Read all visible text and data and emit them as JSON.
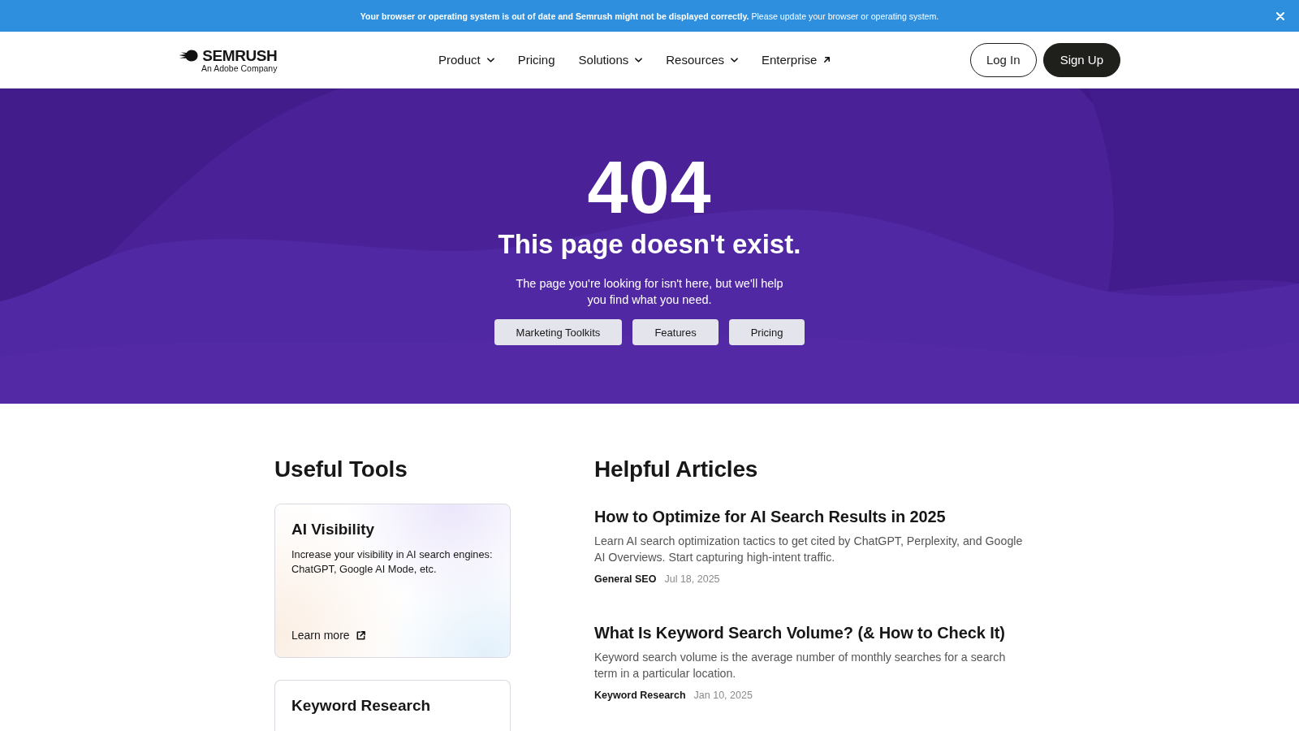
{
  "banner": {
    "message": "**Your browser or operating system is out of date and Semrush might not be displayed correctly.** Please update your browser or operating system."
  },
  "header": {
    "logo": {
      "name": "SEMRUSH",
      "tagline": "An Adobe Company"
    },
    "nav": [
      {
        "label": "Product",
        "kind": "dropdown"
      },
      {
        "label": "Pricing",
        "kind": "link"
      },
      {
        "label": "Solutions",
        "kind": "dropdown"
      },
      {
        "label": "Resources",
        "kind": "dropdown"
      },
      {
        "label": "Enterprise",
        "kind": "external"
      }
    ],
    "buttons": [
      {
        "label": "Log In",
        "kind": "outline"
      },
      {
        "label": "Sign Up",
        "kind": "primary"
      }
    ]
  },
  "hero": {
    "code": "404",
    "title": "This page doesn't exist.",
    "text": "The page you're looking for isn't here, but we'll help you find what you need.",
    "buttons": [
      "Marketing Toolkits",
      "Features",
      "Pricing"
    ]
  },
  "useful_tools": {
    "heading": "Useful Tools",
    "cards": [
      {
        "title": "AI Visibility",
        "description": "Increase your visibility in AI search engines: ChatGPT, Google AI Mode, etc.",
        "link": "Learn more"
      },
      {
        "title": "Keyword Research"
      }
    ]
  },
  "helpful_articles": {
    "heading": "Helpful Articles",
    "articles": [
      {
        "title": "How to Optimize for AI Search Results in 2025",
        "description": "Learn AI search optimization tactics to get cited by ChatGPT, Perplexity, and Google AI Overviews. Start capturing high-intent traffic.",
        "category": "General SEO",
        "date": "Jul 18, 2025"
      },
      {
        "title": "What Is Keyword Search Volume? (& How to Check It)",
        "description": "Keyword search volume is the average number of monthly searches for a search term in a particular location.",
        "category": "Keyword Research",
        "date": "Jan 10, 2025"
      }
    ]
  }
}
